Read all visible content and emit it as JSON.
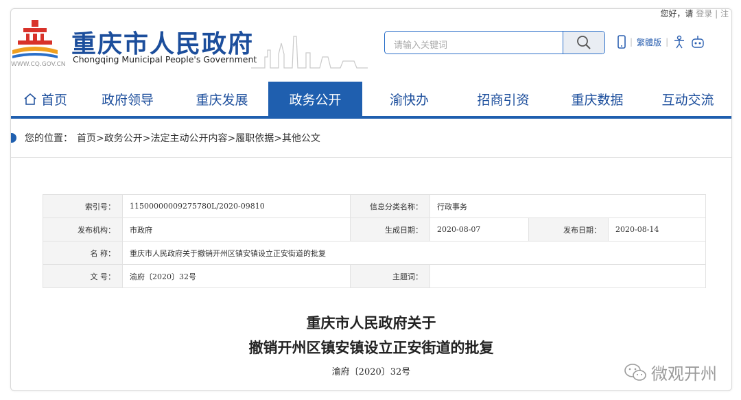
{
  "header": {
    "greeting": "您好，请",
    "login": "登录",
    "sep": "|",
    "extra": "注",
    "url": "WWW.CQ.GOV.CN",
    "title": "重庆市人民政府",
    "subtitle": "Chongqing Municipal People's Government",
    "search_placeholder": "请输入关键词",
    "traditional": "繁體版",
    "sep2": "|",
    "sep3": "|"
  },
  "nav": {
    "items": [
      {
        "label": "首页"
      },
      {
        "label": "政府领导"
      },
      {
        "label": "重庆发展"
      },
      {
        "label": "政务公开"
      },
      {
        "label": "渝快办"
      },
      {
        "label": "招商引资"
      },
      {
        "label": "重庆数据"
      },
      {
        "label": "互动交流"
      }
    ],
    "active_index": 3
  },
  "breadcrumb": {
    "prefix": "您的位置：",
    "path": "首页>政务公开>法定主动公开内容>履职依据>其他公文"
  },
  "info": {
    "index_label": "索引号：",
    "index_value": "11500000009275780L/2020-09810",
    "category_label": "信息分类名称：",
    "category_value": "行政事务",
    "issuer_label": "发布机构：",
    "issuer_value": "市政府",
    "created_label": "生成日期：",
    "created_value": "2020-08-07",
    "published_label": "发布日期：",
    "published_value": "2020-08-14",
    "name_label": "名    称：",
    "name_value": "重庆市人民政府关于撤销开州区镇安镇设立正安街道的批复",
    "docno_label": "文  号：",
    "docno_value": "渝府〔2020〕32号",
    "topic_label": "主题词：",
    "topic_value": ""
  },
  "document": {
    "title_line1": "重庆市人民政府关于",
    "title_line2": "撤销开州区镇安镇设立正安街道的批复",
    "doc_number": "渝府〔2020〕32号"
  },
  "watermark": {
    "text": "微观开州"
  },
  "colors": {
    "brand_blue": "#1f5faf",
    "title_blue": "#1c4e9c",
    "logo_red": "#d8322a",
    "logo_orange": "#f0a020"
  }
}
